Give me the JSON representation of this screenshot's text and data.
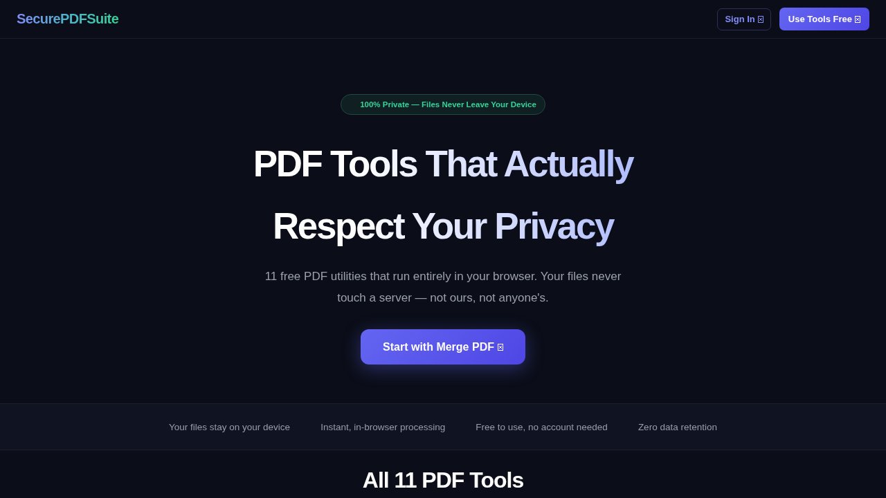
{
  "header": {
    "logo": "SecurePDFSuite",
    "buttons": [
      {
        "label": "Sign In",
        "kind": "outline"
      },
      {
        "label": "Use Tools Free",
        "kind": "filled"
      }
    ]
  },
  "hero": {
    "badge": "100% Private — Files Never Leave Your Device",
    "title": "PDF Tools That Actually Respect Your Privacy",
    "subtitle": "11 free PDF utilities that run entirely in your browser. Your files never touch a server — not ours, not anyone's.",
    "cta": "Start with Merge PDF"
  },
  "features": [
    "Your files stay on your device",
    "Instant, in-browser processing",
    "Free to use, no account needed",
    "Zero data retention"
  ],
  "tools_section": {
    "heading": "All 11 PDF Tools"
  }
}
